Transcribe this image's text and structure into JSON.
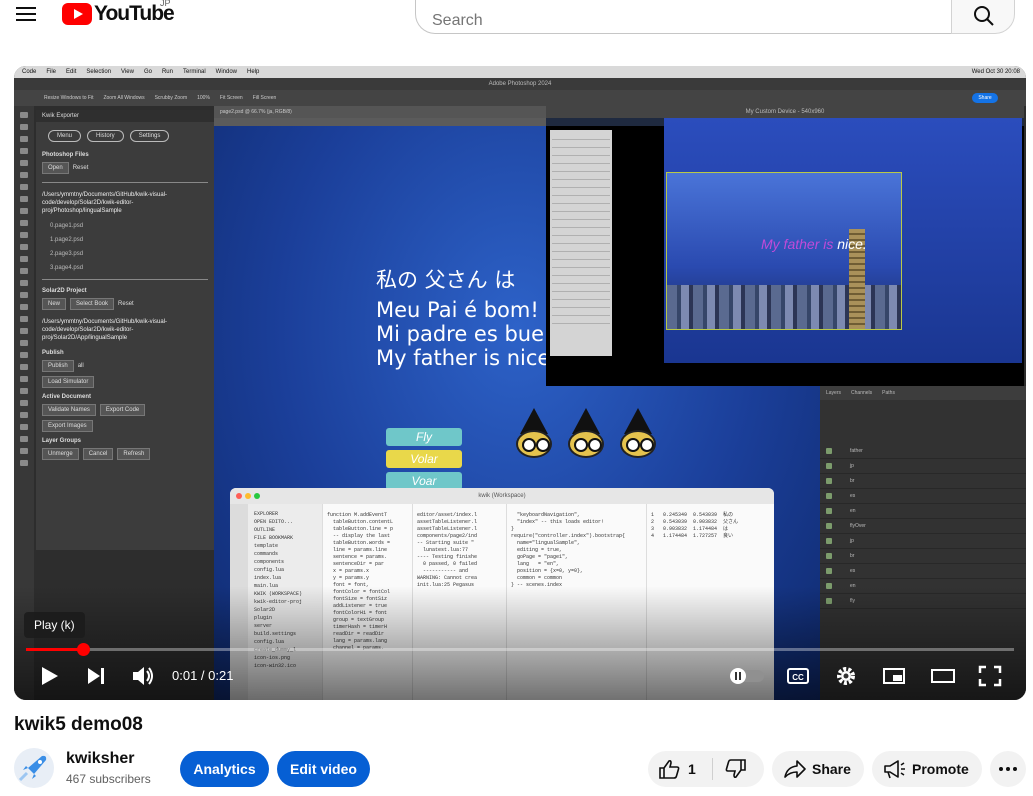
{
  "masthead": {
    "logo_text": "YouTube",
    "country": "JP",
    "search_placeholder": "Search"
  },
  "player": {
    "tooltip": "Play (k)",
    "current_time": "0:01",
    "duration": "0:21",
    "progress_fraction": 0.058,
    "screen": {
      "mac_menu": [
        "Code",
        "File",
        "Edit",
        "Selection",
        "View",
        "Go",
        "Run",
        "Terminal",
        "Window",
        "Help"
      ],
      "mac_clock": "Wed Oct 30  20:08",
      "photoshop_title": "Adobe Photoshop 2024",
      "ps_options": [
        "Resize Windows to Fit",
        "Zoom All Windows",
        "Scrubby Zoom",
        "100%",
        "Fit Screen",
        "Fill Screen"
      ],
      "ps_share": "Share",
      "doc_tab": "page2.psd @ 66.7% (ja, RGB/8)",
      "kwik": {
        "title": "Kwik Exporter",
        "tabs": [
          "Menu",
          "History",
          "Settings"
        ],
        "ps_files_label": "Photoshop Files",
        "open": "Open",
        "reset": "Reset",
        "path1": "/Users/ymmtny/Documents/GitHub/kwik-visual-code/develop/Solar2D/kwik-editor-proj/Photoshop/lingualSample",
        "files": [
          "0.page1.psd",
          "1.page2.psd",
          "2.page3.psd",
          "3.page4.psd"
        ],
        "solar_label": "Solar2D Project",
        "new": "New",
        "select_book": "Select Book",
        "path2": "/Users/ymmtny/Documents/GitHub/kwik-visual-code/develop/Solar2D/kwik-editor-proj/Solar2D/App/lingualSample",
        "publish_label": "Publish",
        "publish": "Publish",
        "all": "all",
        "load_sim": "Load Simulator",
        "active_label": "Active Document",
        "validate": "Validate Names",
        "export_code": "Export Code",
        "export_images": "Export Images",
        "layer_groups": "Layer Groups",
        "unmerge": "Unmerge",
        "cancel": "Cancel",
        "refresh": "Refresh"
      },
      "canvas_lines": [
        "私の 父さん は",
        "Meu Pai é bom!",
        "Mi padre es bue",
        "My father is nice"
      ],
      "canvas_buttons": [
        {
          "label": "Fly",
          "color": "#6fc7c9"
        },
        {
          "label": "Volar",
          "color": "#e9d84a"
        },
        {
          "label": "Voar",
          "color": "#6fc7c9"
        }
      ],
      "sim_title": "My Custom Device - 540x960",
      "sim_text_purple": "My father is",
      "sim_text_white": "nice.",
      "layers_tabs": [
        "Layers",
        "Channels",
        "Paths"
      ],
      "layer_rows": [
        "father",
        "jp",
        "br",
        "es",
        "en",
        "flyOver",
        "jp",
        "br",
        "es",
        "en",
        "fly"
      ],
      "code_title": "kwik (Workspace)",
      "code_sidebar": [
        "EXPLORER",
        "OPEN EDITO...",
        "OUTLINE",
        "FILE BOOKMARK",
        "template",
        "commands",
        "components",
        "config.lua",
        "index.lua",
        "main.lua",
        "KWIK (WORKSPACE)",
        "kwik-editor-proj",
        "Solar2D",
        "plugin",
        "server",
        "build.settings",
        "config.lua",
        "create_dummy_l",
        "icon-ios.png",
        "icon-win32.ico"
      ],
      "code_col1": [
        "function M.addEventT",
        "  tableButton.contentL",
        "  tableButton.line = p",
        "  -- display the last",
        "  tableButton.words =",
        "  line = params.line",
        "  sentence = params.",
        "  sentenceDir = par",
        "  x = params.x",
        "  y = params.y",
        "  font = font,",
        "  fontColor = fontCol",
        "  fontSize = fontSiz",
        "  addListener = true",
        "  fontColorHi = font",
        "  group = textGroup",
        "  timerHash = timerH",
        "  readDir = readDir",
        "  lang = params.lang",
        "  channel = params."
      ],
      "code_col2": [
        "editor/asset/index.l",
        "assetTableListener.l",
        "assetTableListener.l",
        "components/page2/ind",
        "",
        "-- Starting suite \"",
        "  lunatest.lua:77",
        "---- Testing finishe",
        "  0 passed, 0 failed",
        "  ----------- and ",
        "WARNING: Cannot crea",
        "init.lua:25 Pegasus"
      ],
      "code_col3": [
        "  \"keyboardNavigation\",",
        "  \"index\" -- this loads editor!",
        "}",
        "",
        "require(\"controller.index\").bootstrap{",
        "  name=\"lingualSample\",",
        "  editing = true,",
        "  goPage = \"page1\",",
        "  lang   = \"en\",",
        "  position = {x=0, y=0},",
        "  common = common",
        "} -- scenes.index"
      ],
      "code_col4": [
        "1   0.245349  0.543039  私の",
        "2   0.543039  0.903832  父さん",
        "3   0.903832  1.174484  は",
        "4   1.174484  1.727257  良い"
      ]
    }
  },
  "video": {
    "title": "kwik5 demo08"
  },
  "channel": {
    "name": "kwiksher",
    "subscribers": "467 subscribers"
  },
  "actions": {
    "analytics": "Analytics",
    "edit_video": "Edit video",
    "like_count": "1",
    "share": "Share",
    "promote": "Promote"
  }
}
